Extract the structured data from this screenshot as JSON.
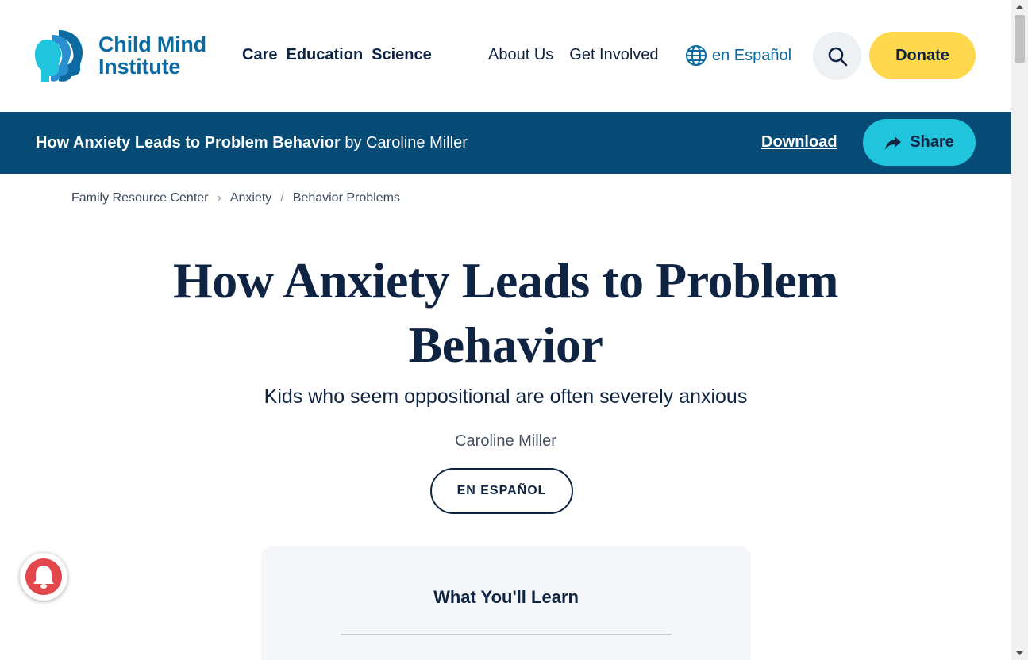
{
  "header": {
    "logo_text": "Child Mind Institute",
    "logo_line1": "Child Mind",
    "logo_line2": "Institute",
    "main_nav": [
      "Care",
      "Education",
      "Science"
    ],
    "util_nav": [
      "About Us",
      "Get Involved"
    ],
    "language_link": "en Español",
    "donate_label": "Donate",
    "brand_color": "#0a6aa1",
    "donate_color": "#ffd84d"
  },
  "article_bar": {
    "title": "How Anxiety Leads to Problem Behavior",
    "byline": "by Caroline Miller",
    "download_label": "Download",
    "share_label": "Share",
    "bar_color": "#054b76",
    "share_color": "#20c4dc"
  },
  "breadcrumb": [
    "Family Resource Center",
    "Anxiety",
    "Behavior Problems"
  ],
  "article": {
    "title_line1": "How Anxiety Leads to Problem",
    "title_line2": "Behavior",
    "subtitle": "Kids who seem oppositional are often severely anxious",
    "author": "Caroline Miller",
    "espanol_button": "EN ESPAÑOL"
  },
  "learn_box": {
    "heading": "What You'll Learn"
  },
  "icons": {
    "search": "search-icon",
    "globe": "globe-icon",
    "share": "share-arrow-icon",
    "bell": "bell-icon",
    "chevron": "chevron-right-icon"
  }
}
